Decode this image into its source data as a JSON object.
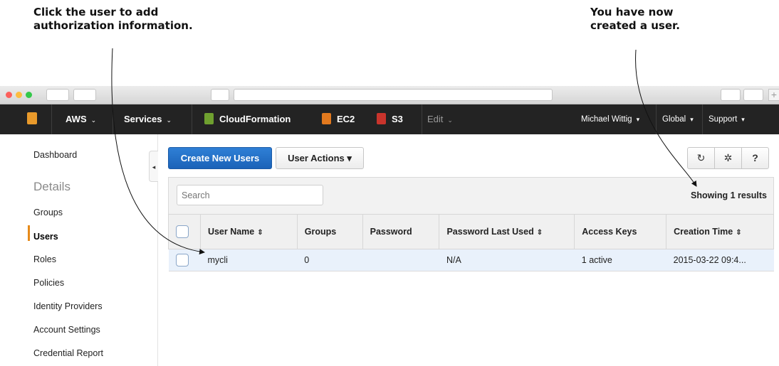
{
  "callouts": {
    "left": [
      "Click the user to add",
      "authorization information."
    ],
    "right": [
      "You have now",
      "created a user."
    ]
  },
  "nav": {
    "aws": "AWS",
    "services": "Services",
    "cloudformation": "CloudFormation",
    "ec2": "EC2",
    "s3": "S3",
    "edit": "Edit",
    "user": "Michael Wittig",
    "region": "Global",
    "support": "Support",
    "caret": "⌄",
    "dropdown_caret": "▾"
  },
  "sidebar": {
    "dashboard": "Dashboard",
    "details": "Details",
    "groups": "Groups",
    "users": "Users",
    "roles": "Roles",
    "policies": "Policies",
    "identity_providers": "Identity Providers",
    "account_settings": "Account Settings",
    "credential_report": "Credential Report",
    "collapse": "◂"
  },
  "toolbar": {
    "create_new_users": "Create New Users",
    "user_actions": "User Actions ▾",
    "refresh": "↻",
    "settings": "✲",
    "help": "?"
  },
  "search": {
    "placeholder": "Search"
  },
  "results_text": "Showing 1 results",
  "table": {
    "headers": [
      "User Name",
      "Groups",
      "Password",
      "Password Last Used",
      "Access Keys",
      "Creation Time"
    ],
    "sort_glyph": "⇕",
    "rows": [
      {
        "user_name": "mycli",
        "groups": "0",
        "password": "",
        "password_last_used": "N/A",
        "access_keys": "1 active",
        "creation_time": "2015-03-22 09:4..."
      }
    ]
  },
  "colors": {
    "nav_bg": "#232323",
    "primary": "#1f6dc4",
    "active_accent": "#e68a1a",
    "selected_row": "#e9f1fb"
  }
}
